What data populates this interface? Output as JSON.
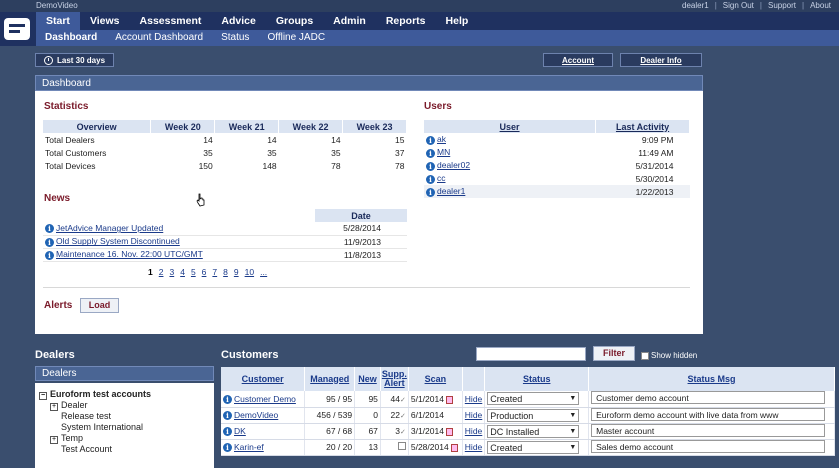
{
  "app_name": "DemoVideo",
  "top_links": [
    "dealer1",
    "Sign Out",
    "Support",
    "About"
  ],
  "main_nav": [
    "Start",
    "Views",
    "Assessment",
    "Advice",
    "Groups",
    "Admin",
    "Reports",
    "Help"
  ],
  "sub_nav": [
    "Dashboard",
    "Account Dashboard",
    "Status",
    "Offline JADC"
  ],
  "range_button": "Last 30 days",
  "account_button": "Account",
  "dealer_info_button": "Dealer Info",
  "dashboard": {
    "title": "Dashboard",
    "statistics": {
      "title": "Statistics",
      "headers": [
        "Overview",
        "Week 20",
        "Week 21",
        "Week 22",
        "Week 23"
      ],
      "rows": [
        {
          "label": "Total Dealers",
          "values": [
            "14",
            "14",
            "14",
            "15"
          ]
        },
        {
          "label": "Total Customers",
          "values": [
            "35",
            "35",
            "35",
            "37"
          ]
        },
        {
          "label": "Total Devices",
          "values": [
            "150",
            "148",
            "78",
            "78"
          ]
        }
      ]
    },
    "users": {
      "title": "Users",
      "headers": [
        "User",
        "Last Activity"
      ],
      "rows": [
        {
          "user": "ak",
          "activity": "9:09 PM"
        },
        {
          "user": "MN",
          "activity": "11:49 AM"
        },
        {
          "user": "dealer02",
          "activity": "5/31/2014"
        },
        {
          "user": "cc",
          "activity": "5/30/2014"
        },
        {
          "user": "dealer1",
          "activity": "1/22/2013"
        }
      ]
    },
    "news": {
      "title": "News",
      "date_header": "Date",
      "rows": [
        {
          "title": "JetAdvice Manager Updated",
          "date": "5/28/2014"
        },
        {
          "title": "Old Supply System Discontinued",
          "date": "11/9/2013"
        },
        {
          "title": "Maintenance 16. Nov. 22:00 UTC/GMT",
          "date": "11/8/2013"
        }
      ],
      "pages": [
        "1",
        "2",
        "3",
        "4",
        "5",
        "6",
        "7",
        "8",
        "9",
        "10",
        "..."
      ]
    },
    "alerts_label": "Alerts",
    "load_button": "Load"
  },
  "dealers": {
    "heading": "Dealers",
    "panel_title": "Dealers",
    "tree": [
      {
        "label": "Euroform test accounts",
        "expander": "−",
        "bold": true
      },
      {
        "label": "Dealer",
        "expander": "+"
      },
      {
        "label": "Release test",
        "expander": ""
      },
      {
        "label": "System International",
        "expander": ""
      },
      {
        "label": "Temp",
        "expander": "+"
      },
      {
        "label": "Test Account",
        "expander": ""
      }
    ]
  },
  "customers": {
    "heading": "Customers",
    "filter_button": "Filter",
    "show_hidden_label": "Show hidden",
    "headers": [
      "Customer",
      "Managed",
      "New",
      "Supp. Alert",
      "Scan",
      "",
      "Status",
      "Status Msg"
    ],
    "rows": [
      {
        "name": "Customer Demo",
        "managed": "95 / 95",
        "new": "95",
        "supp": "44",
        "scan": "5/1/2014",
        "hide": "Hide",
        "status": "Created",
        "msg": "Customer demo account"
      },
      {
        "name": "DemoVideo",
        "managed": "456 / 539",
        "new": "0",
        "supp": "22",
        "scan": "6/1/2014",
        "hide": "Hide",
        "status": "Production",
        "msg": "Euroform demo account with live data from www"
      },
      {
        "name": "DK",
        "managed": "67 / 68",
        "new": "67",
        "supp": "3",
        "scan": "3/1/2014",
        "hide": "Hide",
        "status": "DC Installed",
        "msg": "Master account"
      },
      {
        "name": "Karin-ef",
        "managed": "20 / 20",
        "new": "13",
        "supp": "",
        "scan": "5/28/2014",
        "hide": "Hide",
        "status": "Created",
        "msg": "Sales demo account"
      }
    ]
  }
}
